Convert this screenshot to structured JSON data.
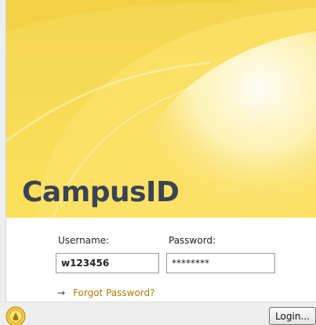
{
  "brand": {
    "title": "CampusID"
  },
  "form": {
    "username_label": "Username:",
    "username_value": "w123456",
    "password_label": "Password:",
    "password_value": "********"
  },
  "links": {
    "forgot_arrow": "→",
    "forgot_password": "Forgot Password?"
  },
  "actions": {
    "login_label": "Login..."
  },
  "icons": {
    "arrow": "right-arrow-icon",
    "logo": "campus-seal-icon"
  },
  "colors": {
    "banner_yellow": "#f7d94a",
    "brand_text": "#3a4354",
    "link": "#a87d0a"
  }
}
